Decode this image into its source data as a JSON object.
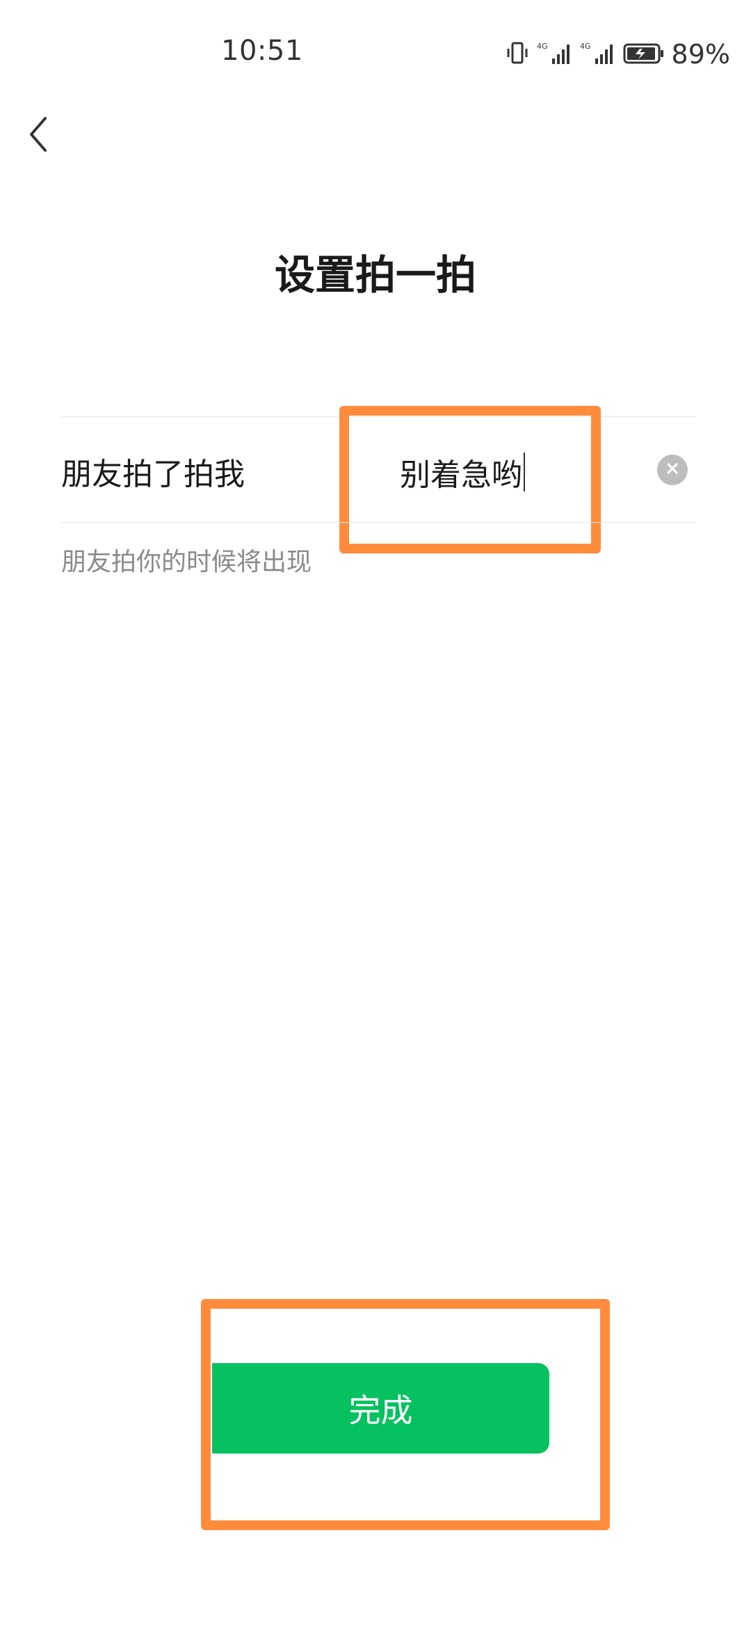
{
  "status_bar": {
    "time": "10:51",
    "battery": "89%",
    "network": "4G"
  },
  "header": {
    "back_icon": "chevron-left-icon",
    "title": "设置拍一拍"
  },
  "form": {
    "label": "朋友拍了拍我",
    "input_value": "别着急哟",
    "clear_icon": "clear-circle-icon",
    "hint": "朋友拍你的时候将出现"
  },
  "actions": {
    "done_label": "完成"
  },
  "colors": {
    "accent": "#07c160",
    "highlight": "#ff8c3d",
    "hint": "#8a8a8a"
  }
}
